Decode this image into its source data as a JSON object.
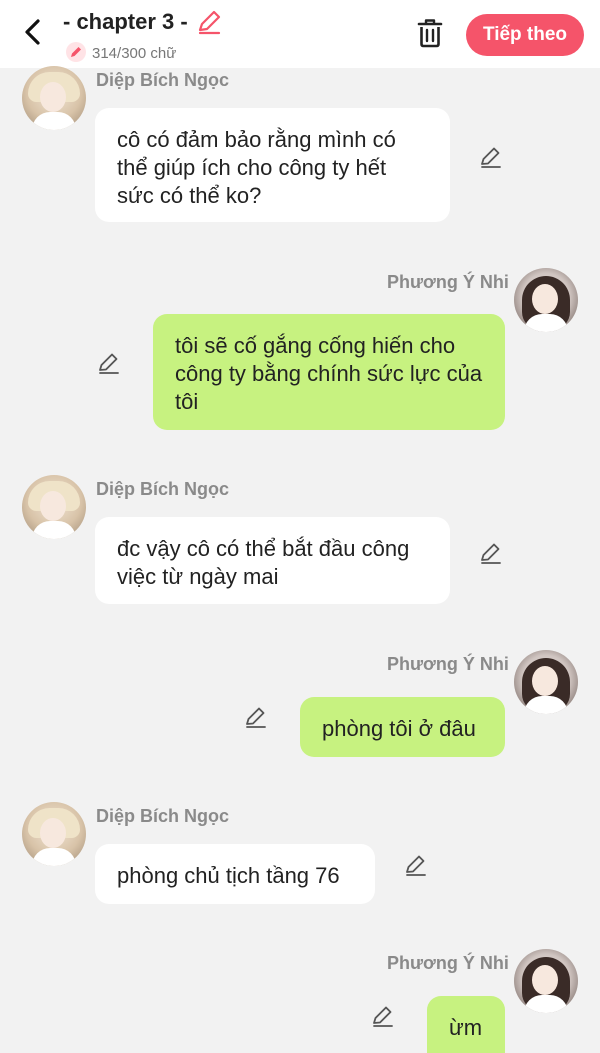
{
  "header": {
    "title": "- chapter 3 -",
    "char_count": "314/300 chữ",
    "next_label": "Tiếp theo",
    "accent_color": "#f5546a"
  },
  "messages": [
    {
      "sender": "Diệp Bích Ngọc",
      "side": "left",
      "text": "cô có đảm bảo rằng mình có thể giúp ích cho công ty hết sức có thể ko?"
    },
    {
      "sender": "Phương Ý Nhi",
      "side": "right",
      "text": "tôi sẽ cố gắng cống hiến cho công ty bằng chính sức lực của tôi"
    },
    {
      "sender": "Diệp Bích Ngọc",
      "side": "left",
      "text": "đc vậy cô có thể bắt đầu công việc từ ngày mai"
    },
    {
      "sender": "Phương Ý Nhi",
      "side": "right",
      "text": "phòng tôi ở đâu"
    },
    {
      "sender": "Diệp Bích Ngọc",
      "side": "left",
      "text": "phòng chủ tịch tầng 76"
    },
    {
      "sender": "Phương Ý Nhi",
      "side": "right",
      "text": "ừm"
    }
  ],
  "icons": {
    "back": "chevron-left-icon",
    "title_edit": "pencil-icon",
    "delete": "trash-icon",
    "message_edit": "pencil-icon"
  }
}
